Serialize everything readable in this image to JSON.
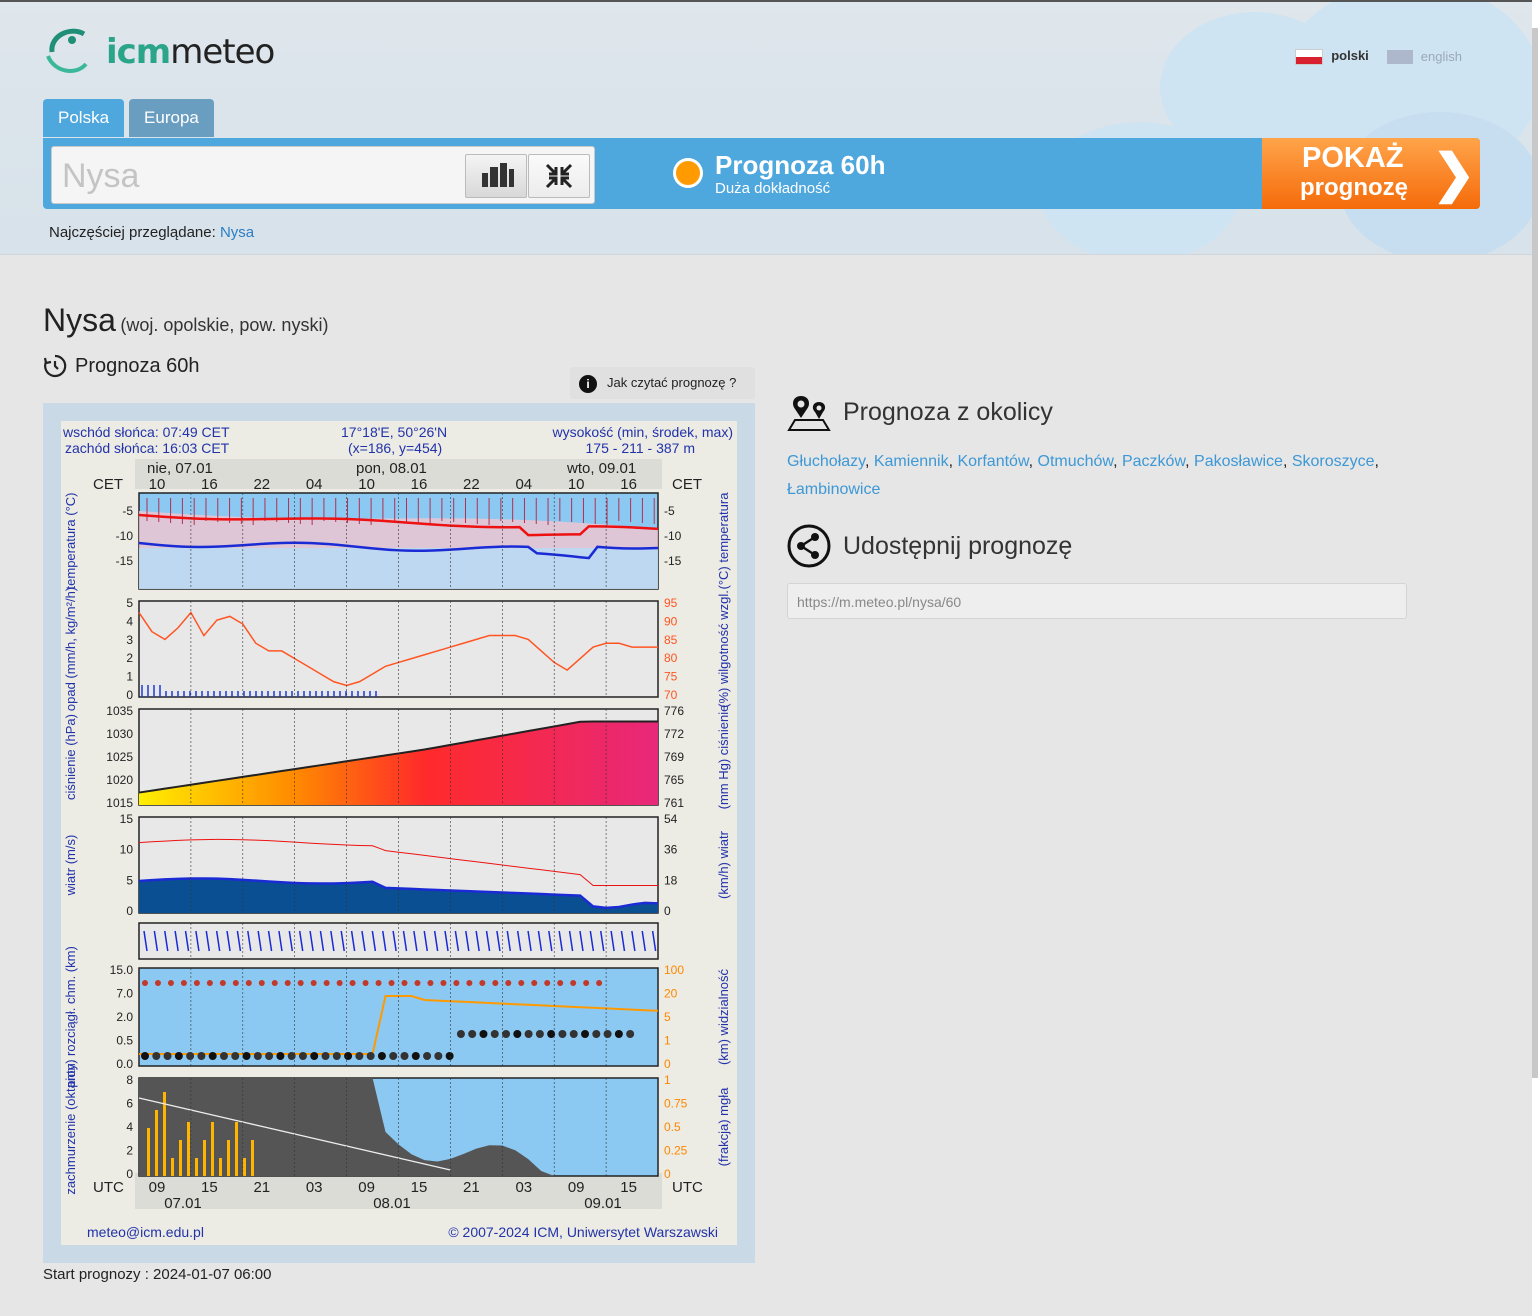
{
  "header": {
    "logo_icm": "icm",
    "logo_meteo": "meteo",
    "lang_pl": "polski",
    "lang_en": "english",
    "tabs": [
      "Polska",
      "Europa"
    ],
    "search_value": "Nysa",
    "forecast_name": "Prognoza 60h",
    "forecast_sub": "Duża dokładność",
    "show_line1": "POKAŻ",
    "show_line2": "prognozę",
    "show_arrow": "❯",
    "freq_label": "Najczęściej przeglądane:",
    "freq_link": "Nysa"
  },
  "main": {
    "city": "Nysa",
    "region": "(woj. opolskie, pow. nyski)",
    "forecast_label": "Prognoza 60h",
    "howto": "Jak czytać prognozę ?",
    "start_label": "Start prognozy : 2024-01-07 06:00"
  },
  "meteogram": {
    "sunrise": "wschód słońca: 07:49 CET",
    "sunset": "zachód słońca: 16:03 CET",
    "coords1": "17°18'E, 50°26'N",
    "coords2": "(x=186, y=454)",
    "alt1": "wysokość (min, środek, max)",
    "alt2": "175 - 211 - 387 m",
    "day1": "nie, 07.01",
    "day2": "pon, 08.01",
    "day3": "wto, 09.01",
    "cet": "CET",
    "utc": "UTC",
    "cet_hours": [
      "10",
      "16",
      "22",
      "04",
      "10",
      "16",
      "22",
      "04",
      "10",
      "16"
    ],
    "utc_hours": [
      "09",
      "15",
      "21",
      "03",
      "09",
      "15",
      "21",
      "03",
      "09",
      "15"
    ],
    "date1": "07.01",
    "date2": "08.01",
    "date3": "09.01",
    "email": "meteo@icm.edu.pl",
    "copyright": "© 2007-2024 ICM, Uniwersytet Warszawski",
    "panel_labels": {
      "temp_l": "temperatura (°C)",
      "temp_r": "(°C) temperatura",
      "rain_l": "opad (mm/h, kg/m²/h)",
      "rain_r": "(%) wilgotność wzgl.",
      "press_l": "ciśnienie (hPa)",
      "press_r": "(mm Hg) ciśnienie",
      "wind_l": "wiatr (m/s)",
      "wind_r": "(km/h) wiatr",
      "cloud_l": "pion. rozciągł. chm. (km)",
      "cloud_r": "(km) widzialność",
      "cov_l": "zachmurzenie (oktanty)",
      "cov_r": "(frakcja) mgła"
    },
    "ticks": {
      "temp": [
        "-5",
        "-10",
        "-15"
      ],
      "rain_l": [
        "5",
        "4",
        "3",
        "2",
        "1",
        "0"
      ],
      "rain_r": [
        "95",
        "90",
        "85",
        "80",
        "75",
        "70"
      ],
      "press_l": [
        "1035",
        "1030",
        "1025",
        "1020",
        "1015"
      ],
      "press_r": [
        "776",
        "772",
        "769",
        "765",
        "761"
      ],
      "wind_l": [
        "15",
        "10",
        "5",
        "0"
      ],
      "wind_r": [
        "54",
        "36",
        "18",
        "0"
      ],
      "cloud_l": [
        "15.0",
        "7.0",
        "2.0",
        "0.5",
        "0.0"
      ],
      "cloud_r": [
        "100",
        "20",
        "5",
        "1",
        "0"
      ],
      "cov_l": [
        "8",
        "6",
        "4",
        "2",
        "0"
      ],
      "cov_r": [
        "1",
        "0.75",
        "0.5",
        "0.25",
        "0"
      ]
    }
  },
  "sidebar": {
    "nearby_title": "Prognoza z okolicy",
    "nearby": [
      "Głuchołazy",
      "Kamiennik",
      "Korfantów",
      "Otmuchów",
      "Paczków",
      "Pakosławice",
      "Skoroszyce",
      "Łambinowice"
    ],
    "share_title": "Udostępnij prognozę",
    "share_url": "https://m.meteo.pl/nysa/60"
  }
}
